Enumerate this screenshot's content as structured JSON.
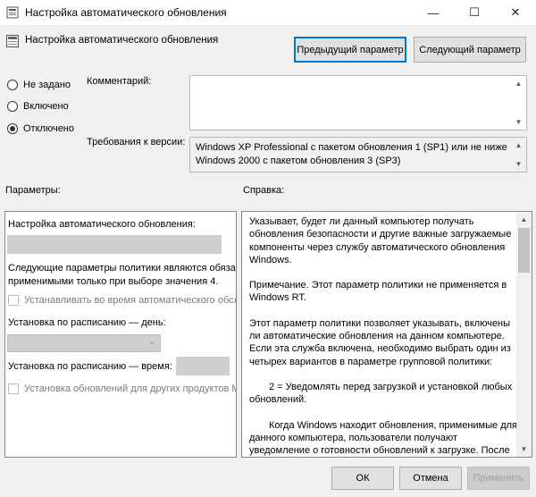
{
  "window": {
    "title": "Настройка автоматического обновления",
    "minimize": "—",
    "maximize": "☐",
    "close": "✕"
  },
  "header": {
    "policy_name": "Настройка автоматического обновления",
    "prev_button": "Предыдущий параметр",
    "next_button": "Следующий параметр"
  },
  "state": {
    "options": [
      "Не задано",
      "Включено",
      "Отключено"
    ],
    "selected_index": 2
  },
  "comment": {
    "label": "Комментарий:",
    "value": ""
  },
  "requirements": {
    "label": "Требования к версии:",
    "lines": [
      "Windows XP Professional с пакетом обновления 1 (SP1) или не ниже",
      "Windows 2000 с пакетом обновления 3 (SP3)"
    ]
  },
  "options_section": {
    "label": "Параметры:",
    "configure_label": "Настройка автоматического обновления:",
    "info_line1": "Следующие параметры политики являются обяза",
    "info_line2": "применимыми только при выборе значения 4.",
    "checkbox1": "Устанавливать во время автоматического обсл",
    "schedule_day_label": "Установка по расписанию — день:",
    "schedule_time_label": "Установка по расписанию — время:",
    "checkbox2": "Установка обновлений для других продуктов М"
  },
  "help_section": {
    "label": "Справка:",
    "paragraphs": [
      "Указывает, будет ли данный компьютер получать обновления безопасности и другие важные загружаемые компоненты через службу автоматического обновления Windows.",
      "Примечание. Этот параметр политики не применяется в Windows RT.",
      "Этот параметр политики позволяет указывать, включены ли автоматические обновления на данном компьютере. Если эта служба включена, необходимо выбрать один из четырех вариантов в параметре групповой политики:",
      "2 = Уведомлять перед загрузкой и установкой любых обновлений.",
      "Когда Windows находит обновления, применимые для данного компьютера, пользователи получают уведомление о готовности обновлений к загрузке. После перехода в Центр обновления Windows пользователи могут загрузить и"
    ]
  },
  "footer": {
    "ok": "ОК",
    "cancel": "Отмена",
    "apply": "Применить"
  },
  "colors": {
    "accent": "#0078d7",
    "window_bg": "#f0f0f0"
  }
}
